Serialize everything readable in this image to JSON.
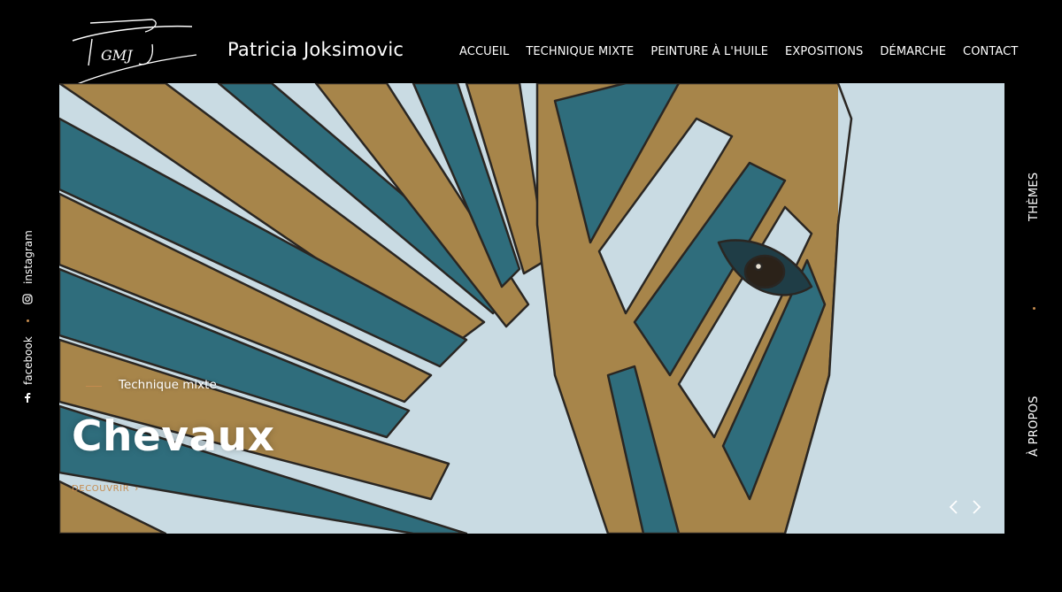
{
  "header": {
    "site_title": "Patricia Joksimovic",
    "logo_text": "PJGMJ"
  },
  "nav": {
    "items": [
      {
        "label": "ACCUEIL",
        "active": true
      },
      {
        "label": "TECHNIQUE MIXTE",
        "active": false
      },
      {
        "label": "PEINTURE À L'HUILE",
        "active": false
      },
      {
        "label": "EXPOSITIONS",
        "active": false
      },
      {
        "label": "DÉMARCHE",
        "active": false
      },
      {
        "label": "CONTACT",
        "active": false
      }
    ]
  },
  "hero": {
    "category": "Technique mixte",
    "title": "Chevaux",
    "cta_label": "DECOUVRIR",
    "cta_arrow": "›",
    "prev_icon": "chevron-left-icon",
    "next_icon": "chevron-right-icon",
    "image_subject": "zebra-painting"
  },
  "social": {
    "facebook_label": "facebook",
    "instagram_label": "instagram"
  },
  "side": {
    "themes_label": "THÈMES",
    "about_label": "À PROPOS"
  },
  "colors": {
    "accent": "#c58b4e",
    "background": "#000000",
    "text": "#ffffff",
    "sky": "#c9dbe3",
    "gold": "#a7854a",
    "teal": "#2f6d7c"
  }
}
